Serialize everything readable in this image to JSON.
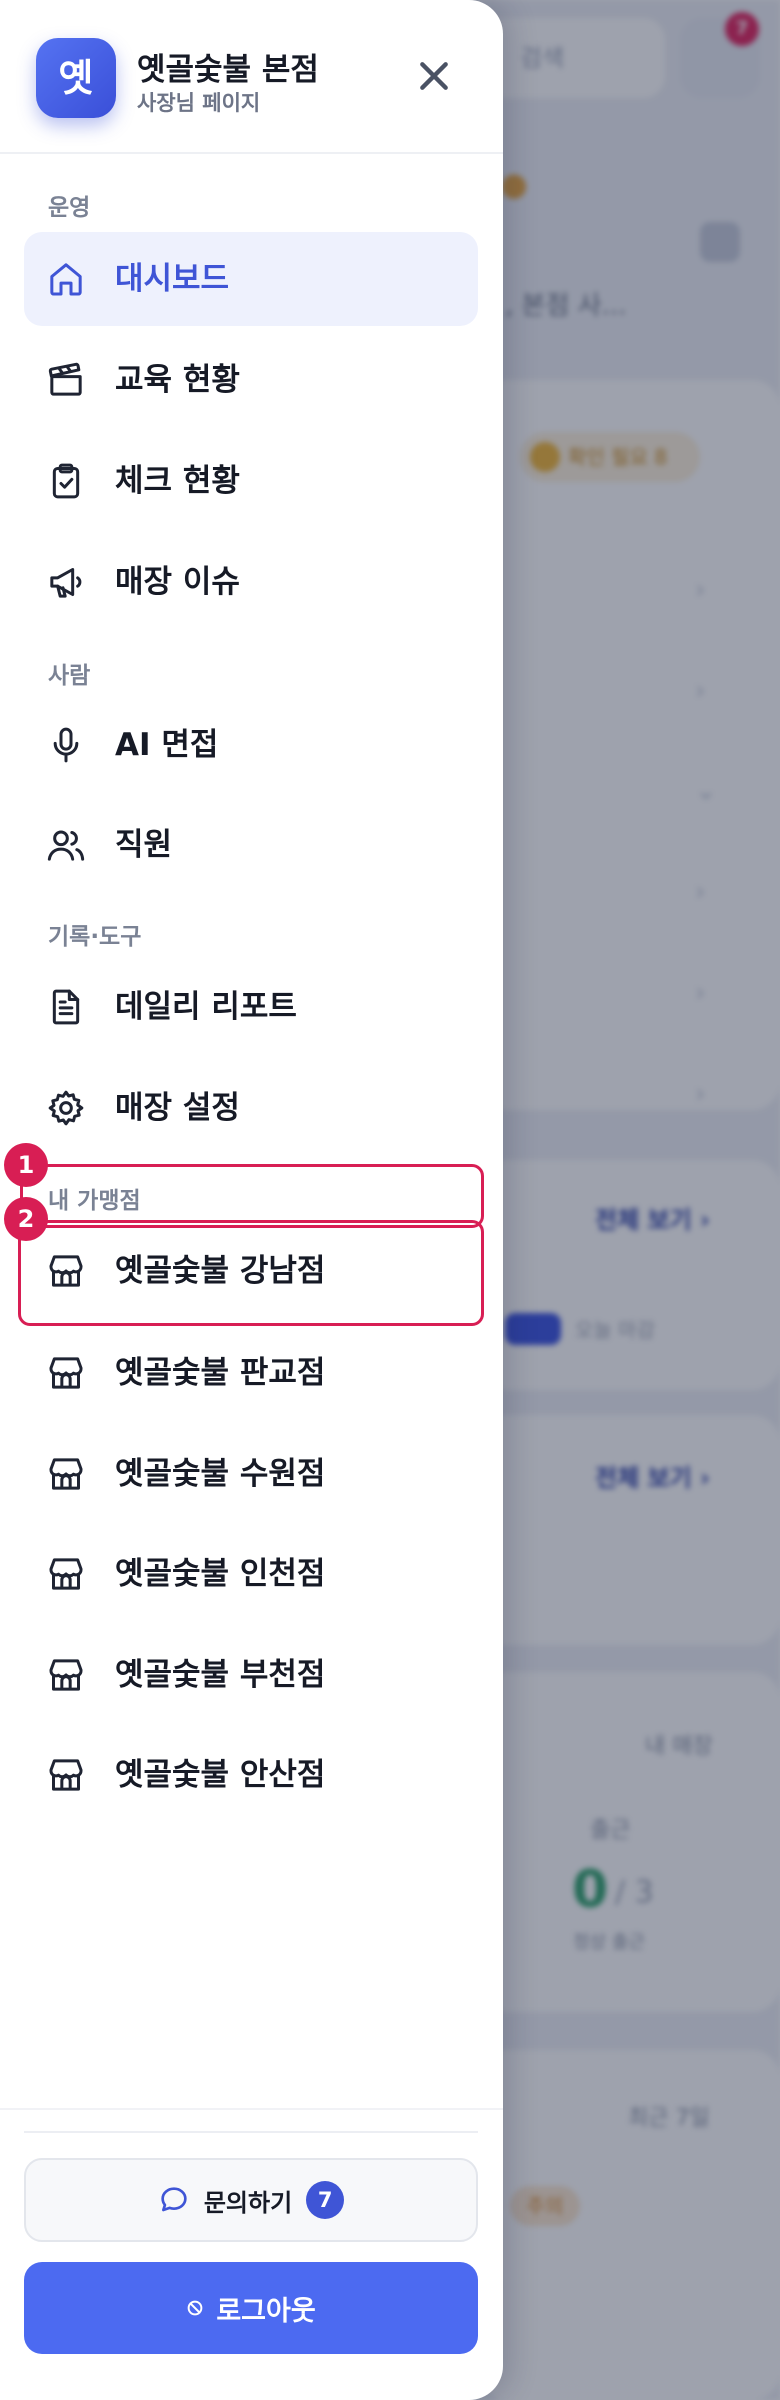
{
  "background": {
    "search_placeholder": "검색",
    "notification_count": "7",
    "greeting": ", 본점 사...",
    "pill_text": "확인 필요 8",
    "link_all_1": "전체 보기 ›",
    "tag_sub": "오늘 마감",
    "link_all_2": "전체 보기 ›",
    "today_label": "내 매장",
    "attend_label": "출근",
    "attend_value": "0",
    "attend_total": "/ 3",
    "attend_sub": "정상 출근",
    "recent_label": "최근 7일",
    "orange_tag": "주의"
  },
  "drawer": {
    "logo_char": "옛",
    "store_name": "옛골숯불 본점",
    "store_sub": "사장님 페이지",
    "sections": {
      "ops": "운영",
      "people": "사람",
      "tools": "기록·도구",
      "franchise": "내 가맹점"
    },
    "items": {
      "dashboard": "대시보드",
      "education": "교육 현황",
      "check": "체크 현황",
      "issues": "매장 이슈",
      "ai_interview": "AI 면접",
      "staff": "직원",
      "daily_report": "데일리 리포트",
      "store_settings": "매장 설정"
    },
    "stores": [
      "옛골숯불 강남점",
      "옛골숯불 판교점",
      "옛골숯불 수원점",
      "옛골숯불 인천점",
      "옛골숯불 부천점",
      "옛골숯불 안산점"
    ],
    "inquiry_label": "문의하기",
    "inquiry_count": "7",
    "logout_label": "로그아웃",
    "markers": [
      "1",
      "2"
    ]
  },
  "colors": {
    "accent": "#3f55d6",
    "active_bg": "#eef1fd",
    "logout_bg": "#4c6af1",
    "highlight": "#d81e54"
  },
  "icons": {
    "dashboard": "home-icon",
    "education": "clapperboard-icon",
    "check": "clipboard-check-icon",
    "issues": "megaphone-icon",
    "ai_interview": "microphone-icon",
    "staff": "users-icon",
    "daily_report": "document-icon",
    "store_settings": "gear-icon",
    "store": "storefront-icon"
  }
}
